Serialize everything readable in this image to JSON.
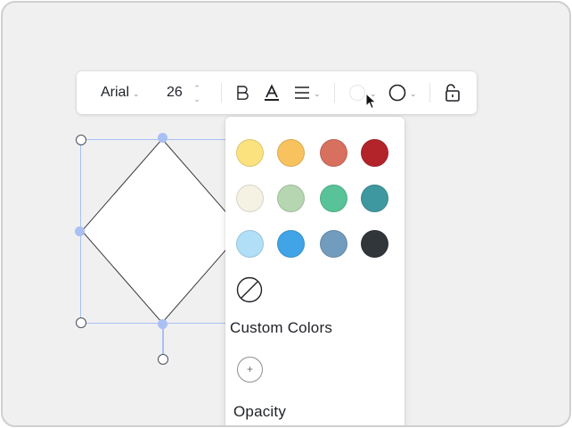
{
  "toolbar": {
    "font_family": "Arial",
    "font_size": "26",
    "stepper_up": "⌃",
    "stepper_down": "⌄",
    "icons": [
      "chevron-down-icon",
      "bold-icon",
      "text-color-icon",
      "align-icon",
      "fill-color-icon",
      "stroke-icon",
      "lock-icon"
    ]
  },
  "color_panel": {
    "swatches": [
      {
        "name": "light-yellow",
        "color": "#FBE27E"
      },
      {
        "name": "orange",
        "color": "#F8C35E"
      },
      {
        "name": "salmon",
        "color": "#D7705F"
      },
      {
        "name": "red",
        "color": "#B3242A"
      },
      {
        "name": "cream",
        "color": "#F5F2E4"
      },
      {
        "name": "sage",
        "color": "#B6D6B1"
      },
      {
        "name": "green",
        "color": "#58C398"
      },
      {
        "name": "teal",
        "color": "#3E989F"
      },
      {
        "name": "light-blue",
        "color": "#B0DFF7"
      },
      {
        "name": "blue",
        "color": "#40A4E6"
      },
      {
        "name": "slate-blue",
        "color": "#729CBE"
      },
      {
        "name": "charcoal",
        "color": "#31363B"
      }
    ],
    "custom_colors_label": "Custom Colors",
    "add_color_symbol": "+",
    "opacity_label": "Opacity"
  },
  "colors": {
    "selection": "#A9C0F5",
    "canvas": "#F0F0F0"
  }
}
